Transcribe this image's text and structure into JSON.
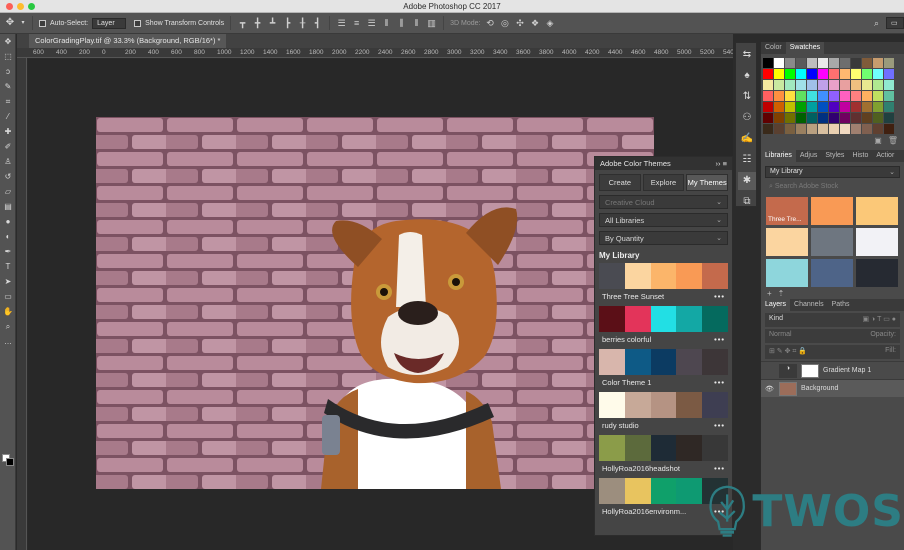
{
  "app": {
    "title": "Adobe Photoshop CC 2017"
  },
  "options_bar": {
    "auto_select_label": "Auto-Select:",
    "auto_select_value": "Layer",
    "show_transform_label": "Show Transform Controls",
    "mode_3d_label": "3D Mode:"
  },
  "document": {
    "tab_title": "ColorGradingPlay.tif @ 33.3% (Background, RGB/16*) *",
    "ruler_ticks": [
      "600",
      "400",
      "200",
      "0",
      "200",
      "400",
      "600",
      "800",
      "1000",
      "1200",
      "1400",
      "1600",
      "1800",
      "2000",
      "2200",
      "2400",
      "2600",
      "2800",
      "3000",
      "3200",
      "3400",
      "3600",
      "3800",
      "4000",
      "4200",
      "4400",
      "4600",
      "4800",
      "5000",
      "5200",
      "5400"
    ]
  },
  "color_themes_panel": {
    "title": "Adobe Color Themes",
    "tabs": [
      "Create",
      "Explore",
      "My Themes"
    ],
    "active_tab": "My Themes",
    "source_select": "Creative Cloud",
    "library_select": "All Libraries",
    "sort_select": "By Quantity",
    "library_title": "My Library",
    "themes": [
      {
        "name": "Three Tree Sunset",
        "colors": [
          "#4a4b52",
          "#fbd5a0",
          "#fbb56a",
          "#f99a55",
          "#c46a4c"
        ]
      },
      {
        "name": "berries colorful",
        "colors": [
          "#5b0f17",
          "#e3345a",
          "#22dfe4",
          "#13a8a5",
          "#056a5e"
        ]
      },
      {
        "name": "Color Theme 1",
        "colors": [
          "#d8b6ac",
          "#0e5a86",
          "#0c3b62",
          "#4e4750",
          "#3d3638"
        ]
      },
      {
        "name": "rudy studio",
        "colors": [
          "#fffbea",
          "#c7a998",
          "#b59383",
          "#7b5a44",
          "#3e3e52"
        ]
      },
      {
        "name": "HollyRoa2016headshot",
        "colors": [
          "#8b9c49",
          "#5c6a3c",
          "#1e2b36",
          "#2f2825",
          "#383838"
        ]
      },
      {
        "name": "HollyRoa2016environm...",
        "colors": [
          "#9c8e7e",
          "#e8c45f",
          "#0fa06a",
          "#0e9a72",
          "#233234"
        ]
      }
    ]
  },
  "color_panel": {
    "tabs": [
      "Color",
      "Swatches"
    ],
    "active_tab": "Swatches",
    "swatches": [
      "#000000",
      "#ffffff",
      "#8a8a8a",
      "#5a5a5a",
      "#bebebe",
      "#e9e9e9",
      "#a9a9a9",
      "#6e6e6e",
      "#3a3a3a",
      "#7f5b3a",
      "#c79c6e",
      "#9a9a7c",
      "#ff0000",
      "#ffff00",
      "#00ff00",
      "#00ffff",
      "#0000ff",
      "#ff00ff",
      "#ff7070",
      "#ffb870",
      "#ffff70",
      "#70ff70",
      "#70ffff",
      "#7070ff",
      "#f5e8a0",
      "#c9e8a0",
      "#a0e8c0",
      "#a0e0e8",
      "#a0c0e8",
      "#c0a0e8",
      "#e8a0c8",
      "#e8a0a0",
      "#f0c080",
      "#e8e890",
      "#b0e890",
      "#90e8d0",
      "#ff6060",
      "#ff9040",
      "#ffe040",
      "#60e060",
      "#40e0e0",
      "#4090ff",
      "#9060ff",
      "#ff60c0",
      "#ff8080",
      "#ffb060",
      "#c0e060",
      "#60c0a0",
      "#c00000",
      "#d06000",
      "#c0c000",
      "#00a000",
      "#00a0a0",
      "#0050c0",
      "#5000c0",
      "#c000a0",
      "#a03030",
      "#a07030",
      "#80a030",
      "#308070",
      "#600000",
      "#804000",
      "#707000",
      "#006000",
      "#006060",
      "#003080",
      "#300070",
      "#700060",
      "#603030",
      "#604020",
      "#506020",
      "#204040",
      "#3a2a1a",
      "#5a4030",
      "#7a6040",
      "#9a8060",
      "#b9a080",
      "#d9c0a0",
      "#e9d0b0",
      "#f0d8c0",
      "#a08070",
      "#806050",
      "#604030",
      "#402010"
    ]
  },
  "libraries_panel": {
    "tabs": [
      "Libraries",
      "Adjus",
      "Styles",
      "Histo",
      "Actior"
    ],
    "active_tab": "Libraries",
    "library": "My Library",
    "search_placeholder": "Search Adobe Stock",
    "items": [
      {
        "label": "Three Tre...",
        "color": "#c46a4c"
      },
      {
        "label": "",
        "color": "#f99a55"
      },
      {
        "label": "",
        "color": "#fbc878"
      },
      {
        "label": "",
        "color": "#fbd5a0"
      },
      {
        "label": "",
        "color": "#6e7680"
      },
      {
        "label": "",
        "color": "#f2f2f6"
      },
      {
        "label": "",
        "color": "#8ed6dc"
      },
      {
        "label": "",
        "color": "#4e6488"
      },
      {
        "label": "",
        "color": "#262a32"
      }
    ]
  },
  "layers_panel": {
    "tabs": [
      "Layers",
      "Channels",
      "Paths"
    ],
    "active_tab": "Layers",
    "filter_label": "Kind",
    "blend_mode": "Normal",
    "opacity_label": "Opacity:",
    "fill_label": "Fill:",
    "layers": [
      {
        "name": "Gradient Map 1"
      },
      {
        "name": "Background"
      }
    ]
  },
  "watermark": {
    "text": "TWOS"
  },
  "colors": {
    "accent": "#2d7d83",
    "panel_bg": "#454545",
    "app_bg": "#282828"
  }
}
